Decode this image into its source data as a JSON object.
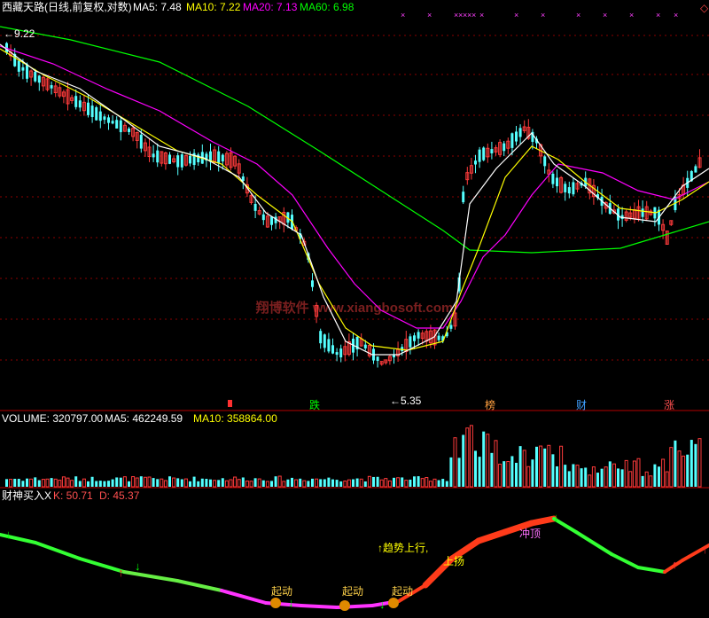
{
  "header": {
    "stock_title": "西藏天路(日线,前复权,对数)",
    "ma5": "MA5: 7.48",
    "ma10": "MA10: 7.22",
    "ma20": "MA20: 7.13",
    "ma60": "MA60: 6.98"
  },
  "colors": {
    "up": "#ff3b3b",
    "down": "#54ffff",
    "ma5": "#ffffff",
    "ma10": "#ffff00",
    "ma20": "#ff00ff",
    "ma60": "#00ff00",
    "grid": "#8b0000",
    "separator": "#b40000"
  },
  "price_panel": {
    "high_label": "9.22",
    "low_label": "5.35",
    "y_axis_top": 9.22,
    "y_axis_bottom": 5.35,
    "watermark": "翔博软件 www.xiangbosoft.com",
    "event_markers": [
      "跌",
      "榜",
      "财",
      "涨"
    ]
  },
  "volume_panel": {
    "title": "VOLUME: 320797.00",
    "ma5": "MA5: 462249.59",
    "ma10": "MA10: 358864.00"
  },
  "indicator_panel": {
    "title": "财神买入X",
    "k_label": "K: 50.71",
    "d_label": "D: 45.37",
    "annotations": [
      "起动",
      "起动",
      "起动",
      "↑趋势上行,",
      "上扬",
      "冲顶"
    ]
  }
}
